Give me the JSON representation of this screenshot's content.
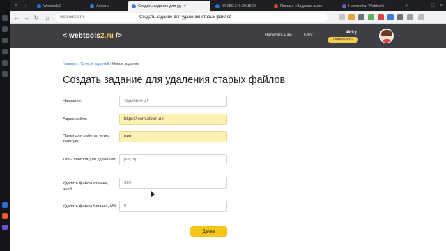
{
  "browser": {
    "tabs": [
      {
        "label": "Webtools2",
        "color": "#2c6fd3"
      },
      {
        "label": "Анкеты",
        "color": "#3a7bd5"
      },
      {
        "label": "Создать задание для уд",
        "color": "#3a7bd5",
        "active": true
      },
      {
        "label": "94.250.249.30:1500",
        "color": "#2c6fd3"
      },
      {
        "label": "Письмо «Задание выпо",
        "color": "#d44638"
      },
      {
        "label": "Настройки Webtools",
        "color": "#7a5cc7"
      }
    ],
    "url": "webtools2.ru",
    "page_title": "Создать задание для удаления старых файлов"
  },
  "site": {
    "logo_prefix": "< webtools",
    "logo_highlight": "2.ru",
    "logo_suffix": " />",
    "nav": {
      "write_us": "Написать нам",
      "blog": "Блог"
    },
    "balance": "49.9 р.",
    "topup": "Пополнить"
  },
  "breadcrumb": {
    "home": "Главная",
    "sep1": "/",
    "tasks": "Список заданий",
    "sep2": "/",
    "current": "Новое задание"
  },
  "title": "Создать задание для удаления старых файлов",
  "form": {
    "name": {
      "label": "Название:",
      "placeholder": "Удаление JT",
      "value": ""
    },
    "site": {
      "label": "Адрес сайта:",
      "value": "https://joomlatown.net"
    },
    "folders": {
      "label": "Папки для работы, через запятую:",
      "value": "free"
    },
    "types": {
      "label": "Типы файлов для удаления:",
      "placeholder": "pdf, zip",
      "value": ""
    },
    "older": {
      "label": "Удалять файлы старше, дней:",
      "placeholder": "360",
      "value": ""
    },
    "bigger": {
      "label": "Удалять файлы больше, Мб:",
      "placeholder": "0",
      "value": ""
    }
  },
  "next_button": "Далее",
  "colors": {
    "header_bg": "#3d3f44",
    "accent_yellow": "#f5c518",
    "filled_field": "#fff1b3",
    "link": "#2b7cd3"
  }
}
